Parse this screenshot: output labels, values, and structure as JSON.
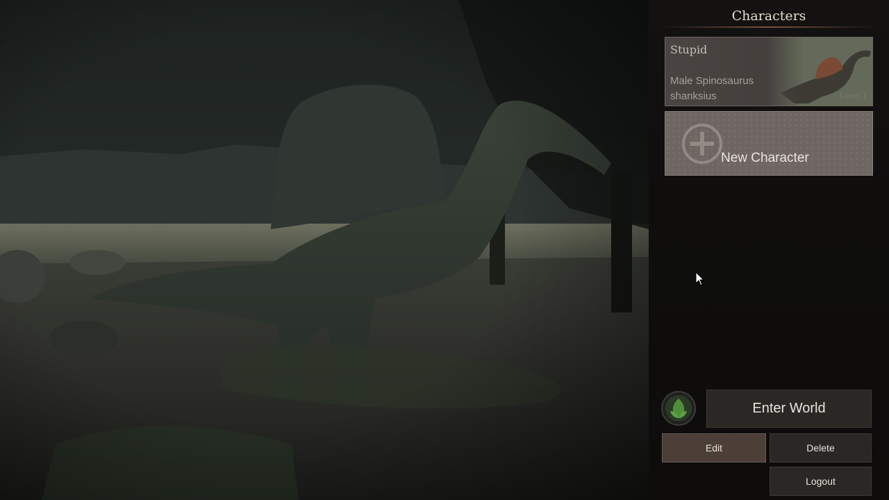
{
  "panel": {
    "title": "Characters"
  },
  "characters": [
    {
      "name": "Stupid",
      "species": "Male Spinosaurus shanksius",
      "level": "Level 1"
    }
  ],
  "new_character": {
    "label": "New Character",
    "icon": "plus-circle-icon"
  },
  "actions": {
    "enter_world": "Enter World",
    "edit": "Edit",
    "delete": "Delete",
    "logout": "Logout"
  },
  "emblem": {
    "icon": "leaf-emblem-icon",
    "color": "#4f8f3a"
  },
  "colors": {
    "panel_bg": "#0f0e0d",
    "card_bg": "#474240",
    "new_card_bg": "#6e6662",
    "button_bg": "#2a2725",
    "edit_bg": "#4b3f38"
  }
}
